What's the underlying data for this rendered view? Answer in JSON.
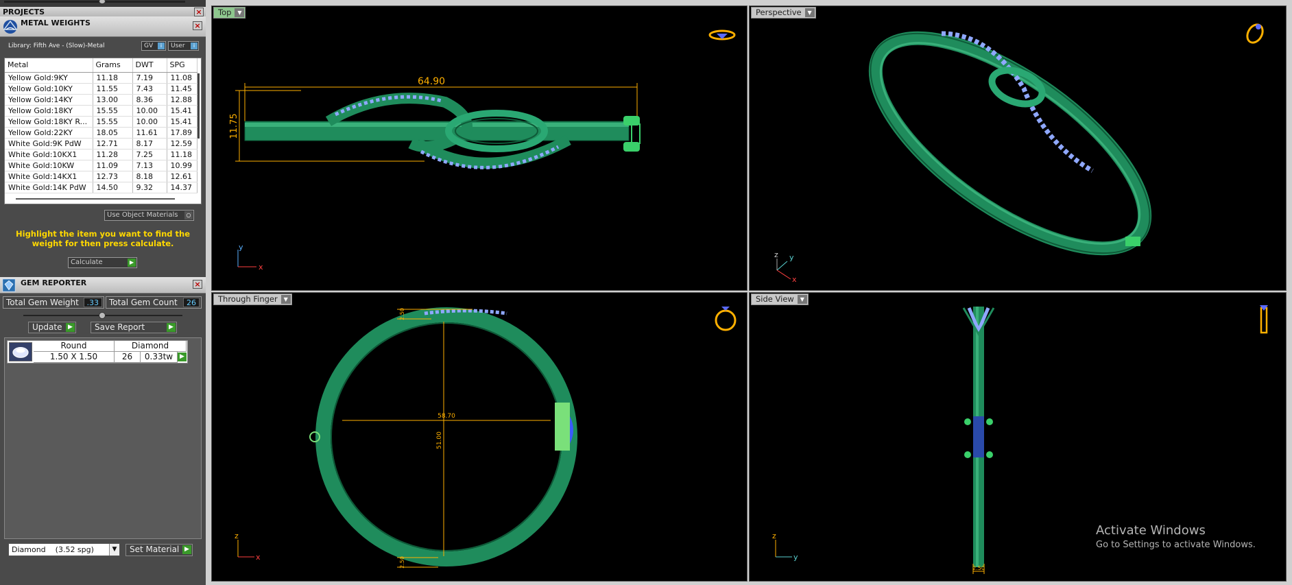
{
  "projects": {
    "title": "PROJECTS"
  },
  "metal_weights": {
    "title": "METAL WEIGHTS",
    "library": "Library: Fifth Ave - (Slow)-Metal",
    "toggle_gv": "GV",
    "toggle_user": "User",
    "columns": [
      "Metal",
      "Grams",
      "DWT",
      "SPG"
    ],
    "rows": [
      [
        "Yellow Gold:9KY",
        "11.18",
        "7.19",
        "11.08"
      ],
      [
        "Yellow Gold:10KY",
        "11.55",
        "7.43",
        "11.45"
      ],
      [
        "Yellow Gold:14KY",
        "13.00",
        "8.36",
        "12.88"
      ],
      [
        "Yellow Gold:18KY",
        "15.55",
        "10.00",
        "15.41"
      ],
      [
        "Yellow Gold:18KY R...",
        "15.55",
        "10.00",
        "15.41"
      ],
      [
        "Yellow Gold:22KY",
        "18.05",
        "11.61",
        "17.89"
      ],
      [
        "White Gold:9K PdW",
        "12.71",
        "8.17",
        "12.59"
      ],
      [
        "White Gold:10KX1",
        "11.28",
        "7.25",
        "11.18"
      ],
      [
        "White Gold:10KW",
        "11.09",
        "7.13",
        "10.99"
      ],
      [
        "White Gold:14KX1",
        "12.73",
        "8.18",
        "12.61"
      ],
      [
        "White Gold:14K PdW",
        "14.50",
        "9.32",
        "14.37"
      ]
    ],
    "use_object_materials": "Use Object Materials",
    "hint": "Highlight the item you want to find the weight for then press calculate.",
    "calculate": "Calculate"
  },
  "gem_reporter": {
    "title": "GEM REPORTER",
    "total_weight_label": "Total Gem Weight",
    "total_weight_value": ".33",
    "total_count_label": "Total Gem Count",
    "total_count_value": "26",
    "update": "Update",
    "save_report": "Save Report",
    "gem": {
      "shape": "Round",
      "type": "Diamond",
      "size": "1.50 X 1.50",
      "count": "26",
      "weight": "0.33tw"
    },
    "material_select": "Diamond    (3.52 spg)",
    "set_material": "Set Material"
  },
  "viewports": {
    "top": {
      "label": "Top",
      "dim_width": "64.90",
      "dim_height": "11.75"
    },
    "perspective": {
      "label": "Perspective"
    },
    "through_finger": {
      "label": "Through Finger",
      "dim_width": "58.70",
      "dim_height": "51.00",
      "dim_top": "2.50",
      "dim_bottom": "2.50"
    },
    "side_view": {
      "label": "Side View",
      "dim_bottom": "2.50"
    }
  },
  "axes": {
    "x": "x",
    "y": "y",
    "z": "z"
  },
  "watermark": {
    "line1": "Activate Windows",
    "line2": "Go to Settings to activate Windows."
  },
  "colors": {
    "metal_green": "#1f8c5c",
    "metal_highlight": "#5ad6a0",
    "gem_blue": "#8fa8ff",
    "dimension": "#ffb000",
    "hint_yellow": "#ffd800",
    "active_label": "#8ec88e"
  }
}
